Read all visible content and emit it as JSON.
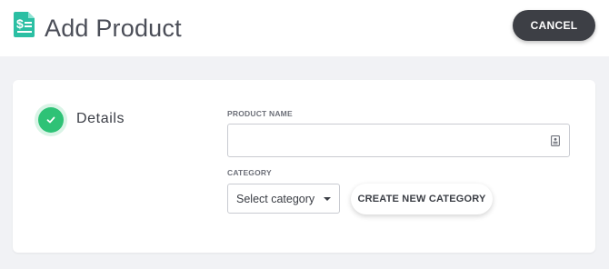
{
  "header": {
    "title": "Add Product",
    "icon": "invoice-dollar-icon",
    "cancel_label": "CANCEL"
  },
  "colors": {
    "brand": "#2bbfa3",
    "success": "#2ec276",
    "dark_button": "#3d3f45",
    "background": "#f1f2f5"
  },
  "steps": [
    {
      "label": "Details",
      "status": "complete",
      "icon": "check-icon"
    }
  ],
  "form": {
    "product_name": {
      "label": "PRODUCT NAME",
      "value": "",
      "icon": "contact-card-icon"
    },
    "category": {
      "label": "CATEGORY",
      "selected": "Select category",
      "icon": "caret-down-icon"
    },
    "create_category_label": "CREATE NEW CATEGORY"
  }
}
